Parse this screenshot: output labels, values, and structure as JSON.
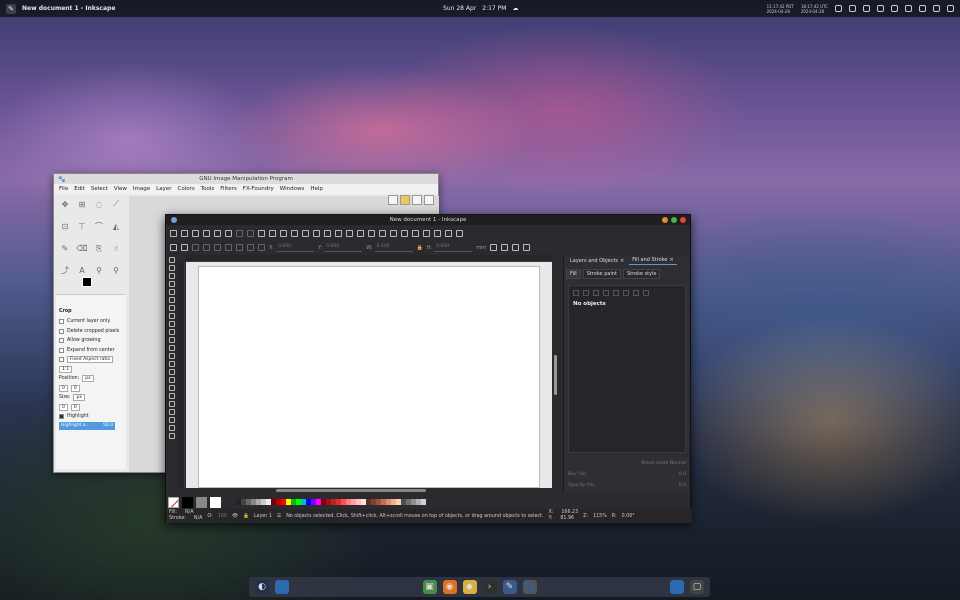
{
  "topbar": {
    "window_title": "New document 1 - Inkscape",
    "date": "Sun 28 Apr",
    "time": "2:17 PM",
    "tz1_time": "11:17:42",
    "tz1_name": "PDT",
    "tz1_date": "2024-04-28",
    "tz2_time": "18:17:42",
    "tz2_name": "UTC",
    "tz2_date": "2024-04-28"
  },
  "gimp": {
    "title": "GNU Image Manipulation Program",
    "menu": [
      "File",
      "Edit",
      "Select",
      "View",
      "Image",
      "Layer",
      "Colors",
      "Tools",
      "Filters",
      "FX-Foundry",
      "Windows",
      "Help"
    ],
    "options": {
      "header": "Crop",
      "checks": [
        "Current layer only",
        "Delete cropped pixels",
        "Allow growing",
        "Expand from center"
      ],
      "aspect": "Fixed Aspect ratio",
      "ratio": "1:1",
      "position_label": "Position:",
      "position_unit": "px",
      "pos_x": "0",
      "pos_y": "0",
      "size_label": "Size:",
      "size_unit": "px",
      "size_w": "0",
      "size_h": "0",
      "highlight_label": "Highlight",
      "highlight_opacity_label": "Highlight o...",
      "highlight_opacity_value": "50.0"
    }
  },
  "inkscape": {
    "title": "New document 1 - Inkscape",
    "coords": {
      "x_label": "X:",
      "x_value": "0.000",
      "y_label": "Y:",
      "y_value": "0.000",
      "w_label": "W:",
      "w_value": "0.000",
      "h_label": "H:",
      "h_value": "0.000",
      "unit": "mm"
    },
    "panel": {
      "tab1": "Layers and Objects",
      "tab2": "Fill and Stroke",
      "sub_fill": "Fill",
      "sub_stroke_paint": "Stroke paint",
      "sub_stroke_style": "Stroke style",
      "no_objects": "No objects",
      "blend_label": "Blend mode",
      "blend_value": "Normal",
      "blur_label": "Blur (%)",
      "blur_value": "0.0",
      "opacity_label": "Opacity (%)",
      "opacity_value": "0.0"
    },
    "status": {
      "fill_label": "Fill:",
      "fill_value": "N/A",
      "stroke_label": "Stroke:",
      "stroke_value": "N/A",
      "opacity_label": "O:",
      "opacity_value": "100",
      "layer": "Layer 1",
      "message": "No objects selected. Click, Shift+click, Alt+scroll mouse on top of objects, or drag around objects to select.",
      "cursor_x_label": "X:",
      "cursor_x": "166.23",
      "cursor_y_label": "Y:",
      "cursor_y": "81.96",
      "zoom_label": "Z:",
      "zoom": "115%",
      "rotation_label": "R:",
      "rotation": "0.00°"
    },
    "palette_colors": [
      "#222222",
      "#444444",
      "#666666",
      "#888888",
      "#aaaaaa",
      "#cccccc",
      "#eeeeee",
      "#7a0000",
      "#c00000",
      "#ff0000",
      "#ffff00",
      "#00c000",
      "#00ff00",
      "#00c0c0",
      "#0000ff",
      "#8000ff",
      "#ff00ff",
      "#800000",
      "#a01010",
      "#c02020",
      "#e03030",
      "#ff5050",
      "#ff8080",
      "#ffa0a0",
      "#ffc0c0",
      "#ffe0e0",
      "#603020",
      "#804030",
      "#a05040",
      "#c07050",
      "#e09070",
      "#f0b090",
      "#ffd0b0",
      "#505050",
      "#707070",
      "#909090",
      "#b0b0b0",
      "#d0d0d0"
    ]
  }
}
